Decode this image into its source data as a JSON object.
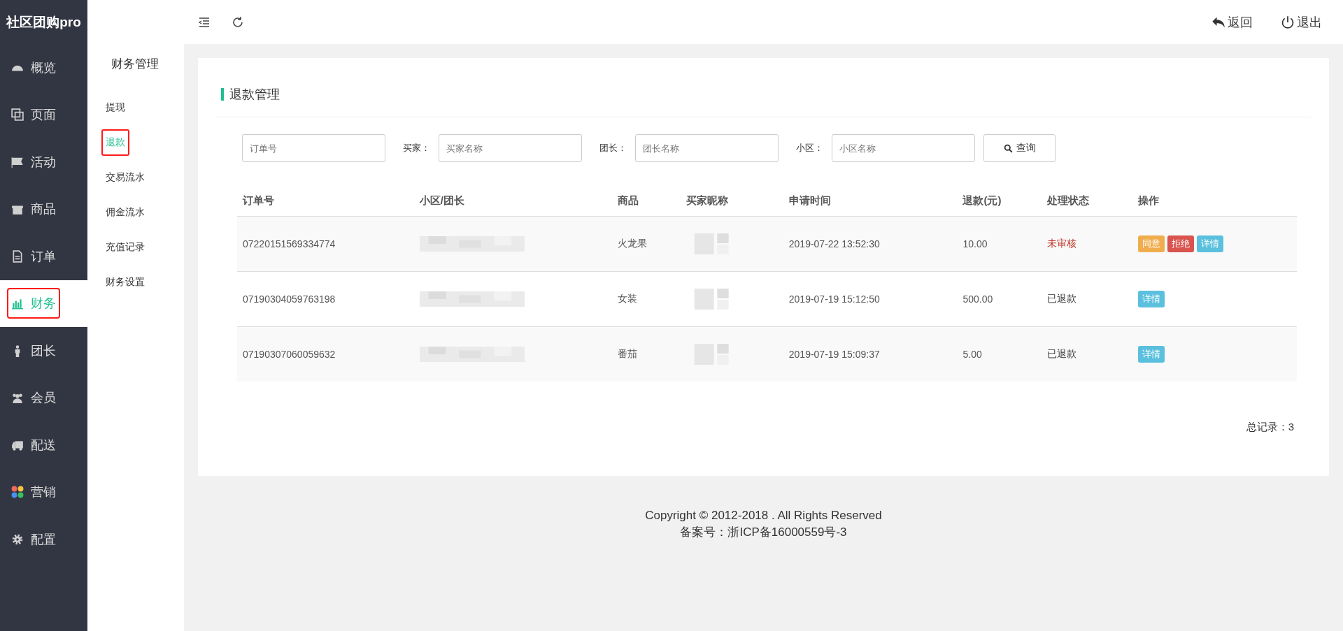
{
  "brand": "社区团购pro",
  "nav": [
    {
      "label": "概览",
      "selected": false,
      "annotated": false
    },
    {
      "label": "页面",
      "selected": false,
      "annotated": false
    },
    {
      "label": "活动",
      "selected": false,
      "annotated": false
    },
    {
      "label": "商品",
      "selected": false,
      "annotated": false
    },
    {
      "label": "订单",
      "selected": false,
      "annotated": false
    },
    {
      "label": "财务",
      "selected": true,
      "annotated": true
    },
    {
      "label": "团长",
      "selected": false,
      "annotated": false
    },
    {
      "label": "会员",
      "selected": false,
      "annotated": false
    },
    {
      "label": "配送",
      "selected": false,
      "annotated": false
    },
    {
      "label": "营销",
      "selected": false,
      "annotated": false
    },
    {
      "label": "配置",
      "selected": false,
      "annotated": false
    }
  ],
  "subnav": {
    "title": "财务管理",
    "items": [
      {
        "label": "提现",
        "selected": false,
        "annotated": false
      },
      {
        "label": "退款",
        "selected": true,
        "annotated": true
      },
      {
        "label": "交易流水",
        "selected": false,
        "annotated": false
      },
      {
        "label": "佣金流水",
        "selected": false,
        "annotated": false
      },
      {
        "label": "充值记录",
        "selected": false,
        "annotated": false
      },
      {
        "label": "财务设置",
        "selected": false,
        "annotated": false
      }
    ]
  },
  "topbar": {
    "back": "返回",
    "logout": "退出"
  },
  "page_title": "退款管理",
  "filters": [
    {
      "placeholder": "订单号"
    },
    {
      "label": "买家：",
      "placeholder": "买家名称"
    },
    {
      "label": "团长：",
      "placeholder": "团长名称"
    },
    {
      "label": "小区：",
      "placeholder": "小区名称"
    }
  ],
  "search_button": "查询",
  "table": {
    "columns": [
      "订单号",
      "小区/团长",
      "商品",
      "买家昵称",
      "申请时间",
      "退款(元)",
      "处理状态",
      "操作"
    ],
    "rows": [
      {
        "order": "07220151569334774",
        "product": "火龙果",
        "time": "2019-07-22 13:52:30",
        "amount": "10.00",
        "status": "未审核",
        "pending": true,
        "actions": [
          {
            "label": "同意",
            "kind": "approve"
          },
          {
            "label": "拒绝",
            "kind": "reject"
          },
          {
            "label": "详情",
            "kind": "detail"
          }
        ]
      },
      {
        "order": "07190304059763198",
        "product": "女装",
        "time": "2019-07-19 15:12:50",
        "amount": "500.00",
        "status": "已退款",
        "pending": false,
        "actions": [
          {
            "label": "详情",
            "kind": "detail"
          }
        ]
      },
      {
        "order": "07190307060059632",
        "product": "番茄",
        "time": "2019-07-19 15:09:37",
        "amount": "5.00",
        "status": "已退款",
        "pending": false,
        "actions": [
          {
            "label": "详情",
            "kind": "detail"
          }
        ]
      }
    ]
  },
  "total_label": "总记录：",
  "total": "3",
  "footer": [
    "Copyright © 2012-2018 . All Rights Reserved",
    "备案号：浙ICP备16000559号-3"
  ]
}
